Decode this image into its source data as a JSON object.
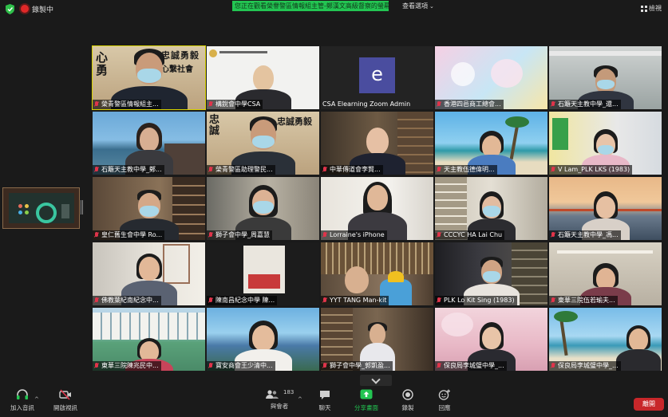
{
  "topbar": {
    "recording_label": "錄製中",
    "banner_text": "您正在觀看榮譽警區情報組主管-鄭漢文高級督察的螢幕",
    "view_options_label": "查看選項",
    "view_options_caret": "⌄",
    "view_button_label": "檢視"
  },
  "participants": [
    {
      "name": "榮青警區情報組主..."
    },
    {
      "name": "構銳會中學CSA"
    },
    {
      "name": "CSA Elearning Zoom Admin",
      "initial": "e"
    },
    {
      "name": "香港四邑商工總會..."
    },
    {
      "name": "石籬天主教中學_還..."
    },
    {
      "name": "石籬天主教中學_鄭..."
    },
    {
      "name": "榮青警區助理警民..."
    },
    {
      "name": "中華傳道會李賢..."
    },
    {
      "name": "天主教伍德偉明..."
    },
    {
      "name": "V Lam_PLK LKS (1983)"
    },
    {
      "name": "皇仁舊生會中學 Ro..."
    },
    {
      "name": "獅子會中學_周嘉慧"
    },
    {
      "name": "Lorraine's iPhone"
    },
    {
      "name": "CCCYC HA Lai Chu"
    },
    {
      "name": "石籬天主教中學_馮..."
    },
    {
      "name": "佛教葉紀南紀念中..."
    },
    {
      "name": "陳南昌紀念中學 陳..."
    },
    {
      "name": "YYT TANG Man-kit"
    },
    {
      "name": "PLK Lo Kit Sing (1983)"
    },
    {
      "name": "東華三院伍若瑜夫..."
    },
    {
      "name": "東華三院陳兆民中..."
    },
    {
      "name": "寶安商會王少清中..."
    },
    {
      "name": "獅子會中學_郭凱盈..."
    },
    {
      "name": "保良局李城璧中學_..."
    },
    {
      "name": "保良局李城璧中學_..."
    }
  ],
  "calligraphy": {
    "line1": "忠誠勇毅",
    "line2": "心繫社會",
    "side1": "心勇",
    "side2": "忠誠"
  },
  "toolbar": {
    "audio_label": "加入音訊",
    "video_label": "開啟視訊",
    "participants_count": "183",
    "participants_label": "與會者",
    "chat_label": "聊天",
    "share_label": "分享畫面",
    "record_label": "錄製",
    "reactions_label": "回應",
    "end_label": "離開",
    "caret": "^"
  },
  "colors": {
    "banner_green": "#23c552",
    "active_speaker_outline": "#d8d200",
    "share_green": "#23c552",
    "end_red": "#c8272a",
    "muted_mic_red": "#e0344a"
  }
}
